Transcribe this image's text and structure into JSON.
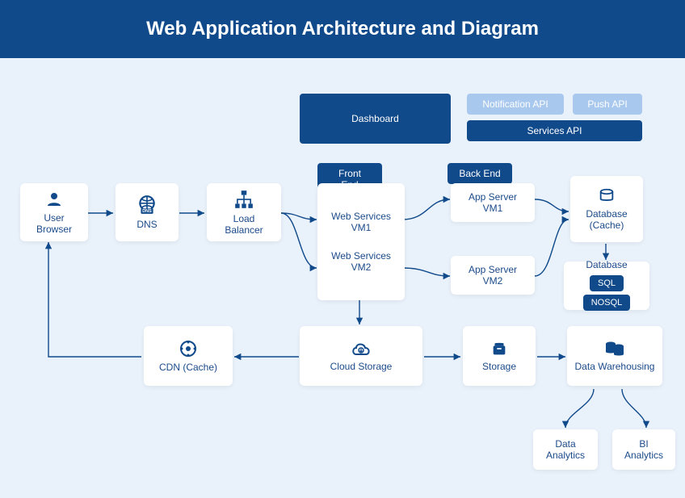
{
  "title": "Web Application Architecture and Diagram",
  "badges": {
    "dashboard": "Dashboard",
    "notificationApi": "Notification API",
    "pushApi": "Push API",
    "servicesApi": "Services API",
    "frontEnd": "Front End",
    "backEnd": "Back End"
  },
  "nodes": {
    "userBrowser": "User Browser",
    "dns": "DNS",
    "loadBalancer": "Load Balancer",
    "webServicesVm1": "Web Services VM1",
    "webServicesVm2": "Web Services VM2",
    "appServerVm1": "App Server VM1",
    "appServerVm2": "App Server VM2",
    "databaseCache": "Database (Cache)",
    "database": "Database",
    "sql": "SQL",
    "nosql": "NOSQL",
    "cdn": "CDN (Cache)",
    "cloudStorage": "Cloud Storage",
    "storage": "Storage",
    "dataWarehousing": "Data Warehousing",
    "dataAnalytics": "Data Analytics",
    "biAnalytics": "BI Analytics"
  }
}
